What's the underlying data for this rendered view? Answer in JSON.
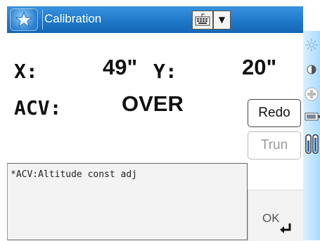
{
  "titlebar": {
    "title": "Calibration"
  },
  "fields": {
    "x_label": "X:",
    "x_value": "49\"",
    "y_label": "Y:",
    "y_value": "20\"",
    "acv_label": "ACV:",
    "acv_value": "OVER"
  },
  "buttons": {
    "redo": "Redo",
    "trun": "Trun",
    "ok": "OK"
  },
  "note": "*ACV:Altitude const adj",
  "colors": {
    "titlebar": "#1f78c9",
    "sidebar": "#a9dcff",
    "disabled_text": "#9a9a9a"
  },
  "icons": [
    "start-icon",
    "keyboard-icon",
    "dropdown-arrow-icon",
    "enter-icon",
    "sun-icon",
    "contrast-icon",
    "plus-icon",
    "battery-icon",
    "signal-icon"
  ]
}
